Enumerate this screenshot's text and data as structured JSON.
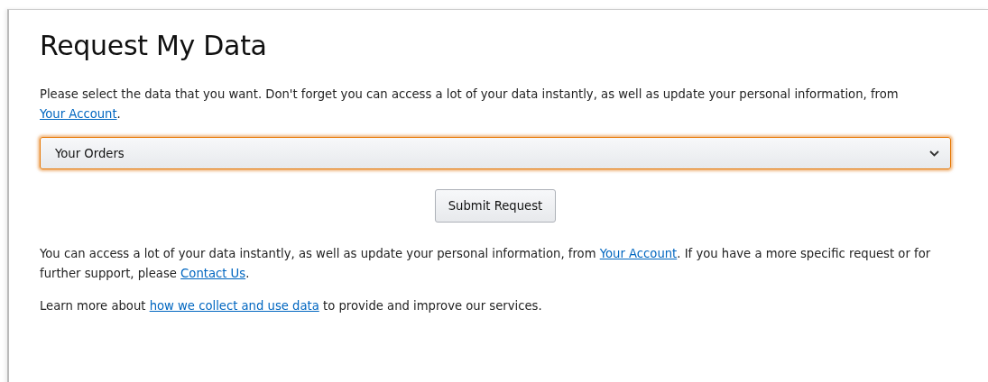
{
  "title": "Request My Data",
  "intro": [
    {
      "kind": "text",
      "text": "Please select the data that you want. Don't forget you can access a lot of your data instantly, as well as update your personal information, from "
    },
    {
      "kind": "link",
      "text": "Your Account"
    },
    {
      "kind": "text",
      "text": "."
    }
  ],
  "select": {
    "value": "Your Orders",
    "focused": true
  },
  "button": "Submit Request",
  "paragraphs": [
    [
      {
        "kind": "text",
        "text": "You can access a lot of your data instantly, as well as update your personal information, from "
      },
      {
        "kind": "link",
        "text": "Your Account"
      },
      {
        "kind": "text",
        "text": ". If you have a more specific request or for further support, please "
      },
      {
        "kind": "link",
        "text": "Contact Us"
      },
      {
        "kind": "text",
        "text": "."
      }
    ],
    [
      {
        "kind": "text",
        "text": "Learn more about "
      },
      {
        "kind": "link",
        "text": "how we collect and use data"
      },
      {
        "kind": "text",
        "text": " to provide and improve our services."
      }
    ]
  ]
}
